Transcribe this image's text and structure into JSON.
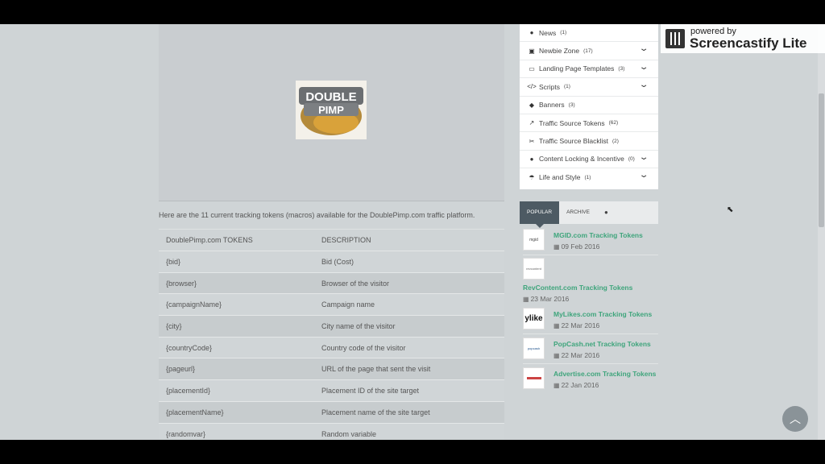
{
  "intro": "Here are the 11 current tracking tokens (macros) available for the DoublePimp.com traffic platform.",
  "hero_logo": {
    "text_top": "DOUBLE",
    "text_bottom": "PIMP"
  },
  "table": {
    "headers": [
      "DoublePimp.com TOKENS",
      "DESCRIPTION"
    ],
    "rows": [
      [
        "{bid}",
        "Bid (Cost)"
      ],
      [
        "{browser}",
        "Browser of the visitor"
      ],
      [
        "{campaignName}",
        "Campaign name"
      ],
      [
        "{city}",
        "City name of the visitor"
      ],
      [
        "{countryCode}",
        "Country code of the visitor"
      ],
      [
        "{pageurl}",
        "URL of the page that sent the visit"
      ],
      [
        "{placementId}",
        "Placement ID of the site target"
      ],
      [
        "{placementName}",
        "Placement name of the site target"
      ],
      [
        "{randomvar}",
        "Random variable"
      ]
    ]
  },
  "categories": [
    {
      "label": "News",
      "count": "(1)",
      "icon": "globe-icon",
      "glyph": "●",
      "expandable": false
    },
    {
      "label": "Newbie Zone",
      "count": "(17)",
      "icon": "briefcase-icon",
      "glyph": "▣",
      "expandable": true
    },
    {
      "label": "Landing Page Templates",
      "count": "(3)",
      "icon": "laptop-icon",
      "glyph": "▭",
      "expandable": true
    },
    {
      "label": "Scripts",
      "count": "(1)",
      "icon": "code-icon",
      "glyph": "</>",
      "expandable": true
    },
    {
      "label": "Banners",
      "count": "(3)",
      "icon": "tag-icon",
      "glyph": "◆",
      "expandable": false
    },
    {
      "label": "Traffic Source Tokens",
      "count": "(62)",
      "icon": "chart-line-icon",
      "glyph": "↗",
      "expandable": false
    },
    {
      "label": "Traffic Source Blacklist",
      "count": "(2)",
      "icon": "scissors-icon",
      "glyph": "✂",
      "expandable": false
    },
    {
      "label": "Content Locking & Incentive",
      "count": "(0)",
      "icon": "bomb-icon",
      "glyph": "●",
      "expandable": true
    },
    {
      "label": "Life and Style",
      "count": "(1)",
      "icon": "umbrella-icon",
      "glyph": "☂",
      "expandable": true
    }
  ],
  "tabs": {
    "popular": "POPULAR",
    "archive": "ARCHIVE"
  },
  "posts": [
    {
      "title": "MGID.com Tracking Tokens",
      "date": "09 Feb 2016",
      "thumb": "mgid"
    },
    {
      "title": "RevContent.com Tracking Tokens",
      "date": "23 Mar 2016",
      "thumb": "revcontent"
    },
    {
      "title": "MyLikes.com Tracking Tokens",
      "date": "22 Mar 2016",
      "thumb": "ylike"
    },
    {
      "title": "PopCash.net Tracking Tokens",
      "date": "22 Mar 2016",
      "thumb": "popcash"
    },
    {
      "title": "Advertise.com Tracking Tokens",
      "date": "22 Jan 2016",
      "thumb": ""
    }
  ],
  "watermark": {
    "line1": "powered by",
    "line2": "Screencastify Lite"
  },
  "colors": {
    "accent": "#3fa57c",
    "tab_active": "#4d5a63",
    "page_bg": "#cfd4d6"
  }
}
